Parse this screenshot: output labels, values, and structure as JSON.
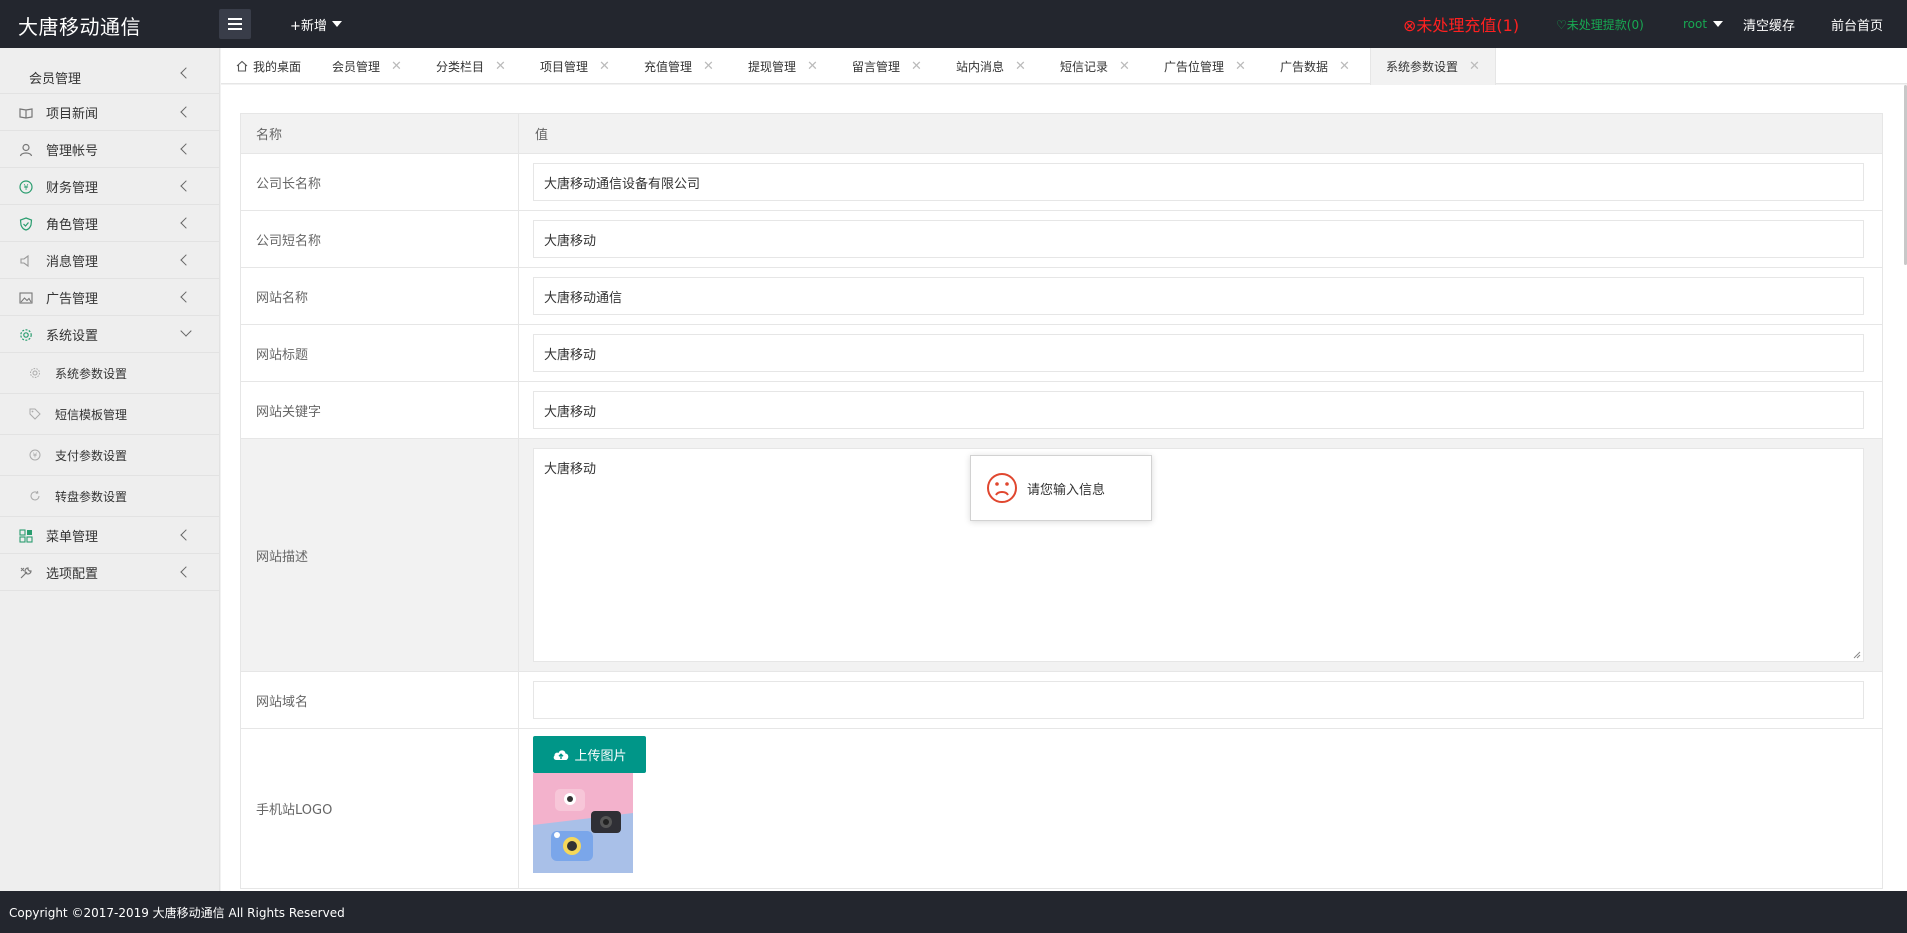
{
  "header": {
    "logo": "大唐移动通信",
    "add_new": "+新增",
    "recharge_alert": "⊗未处理充值(1)",
    "withdraw_alert": "♡未处理提款(0)",
    "user": "root",
    "clear_cache": "清空缓存",
    "front_home": "前台首页"
  },
  "sidebar": {
    "items": [
      {
        "label": "会员管理",
        "icon": "none"
      },
      {
        "label": "项目新闻",
        "icon": "book-icon"
      },
      {
        "label": "管理帐号",
        "icon": "user-icon"
      },
      {
        "label": "财务管理",
        "icon": "money-icon"
      },
      {
        "label": "角色管理",
        "icon": "shield-icon"
      },
      {
        "label": "消息管理",
        "icon": "speaker-icon"
      },
      {
        "label": "广告管理",
        "icon": "picture-icon"
      },
      {
        "label": "系统设置",
        "icon": "gear-icon"
      }
    ],
    "sub_items": [
      {
        "label": "系统参数设置",
        "icon": "gear-icon"
      },
      {
        "label": "短信模板管理",
        "icon": "tag-icon"
      },
      {
        "label": "支付参数设置",
        "icon": "money-icon"
      },
      {
        "label": "转盘参数设置",
        "icon": "refresh-icon"
      }
    ],
    "after_items": [
      {
        "label": "菜单管理",
        "icon": "grid-icon"
      },
      {
        "label": "选项配置",
        "icon": "tools-icon"
      }
    ]
  },
  "tabs": [
    {
      "label": "我的桌面"
    },
    {
      "label": "会员管理"
    },
    {
      "label": "分类栏目"
    },
    {
      "label": "项目管理"
    },
    {
      "label": "充值管理"
    },
    {
      "label": "提现管理"
    },
    {
      "label": "留言管理"
    },
    {
      "label": "站内消息"
    },
    {
      "label": "短信记录"
    },
    {
      "label": "广告位管理"
    },
    {
      "label": "广告数据"
    },
    {
      "label": "系统参数设置"
    }
  ],
  "table": {
    "head_name": "名称",
    "head_value": "值",
    "rows": [
      {
        "name": "公司长名称",
        "value": "大唐移动通信设备有限公司"
      },
      {
        "name": "公司短名称",
        "value": "大唐移动"
      },
      {
        "name": "网站名称",
        "value": "大唐移动通信"
      },
      {
        "name": "网站标题",
        "value": "大唐移动"
      },
      {
        "name": "网站关键字",
        "value": "大唐移动"
      },
      {
        "name": "网站描述",
        "value": "大唐移动"
      },
      {
        "name": "网站域名",
        "value": ""
      },
      {
        "name": "手机站LOGO",
        "value": ""
      }
    ],
    "upload_label": "上传图片"
  },
  "toast": {
    "message": "请您输入信息"
  },
  "footer": {
    "copyright": "Copyright ©2017-2019 大唐移动通信 All Rights Reserved"
  },
  "colors": {
    "header_bg": "#23262e",
    "accent": "#009688",
    "alert_red": "#ff2020",
    "alert_green": "#18a852"
  }
}
